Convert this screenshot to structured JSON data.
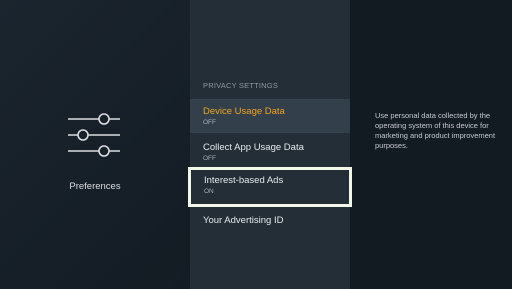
{
  "left": {
    "category_label": "Preferences",
    "icon": "sliders-icon"
  },
  "center": {
    "section_header": "PRIVACY SETTINGS",
    "items": [
      {
        "title": "Device Usage Data",
        "status": "OFF"
      },
      {
        "title": "Collect App Usage Data",
        "status": "OFF"
      },
      {
        "title": "Interest-based Ads",
        "status": "ON"
      },
      {
        "title": "Your Advertising ID",
        "status": ""
      }
    ]
  },
  "right": {
    "description": "Use personal data collected by the operating system of this device for marketing and product improvement purposes."
  },
  "colors": {
    "highlight_text": "#f0a31e",
    "focus_border": "#f3f9e9"
  }
}
